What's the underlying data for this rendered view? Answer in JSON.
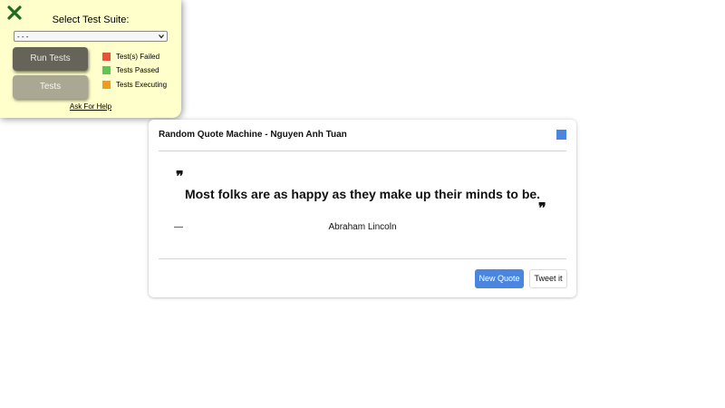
{
  "test_panel": {
    "close_icon": "close-x-icon",
    "title": "Select Test Suite:",
    "select_value": "- - -",
    "run_button": "Run Tests",
    "tests_button": "Tests",
    "legend": [
      {
        "label": "Test(s) Failed",
        "color": "#e8513a"
      },
      {
        "label": "Tests Passed",
        "color": "#5cc852"
      },
      {
        "label": "Tests Executing",
        "color": "#f19a1e"
      }
    ],
    "help_link": "Ask For Help",
    "colors": {
      "panel_bg": "#ffffcc",
      "close_icon": "#1f6b1f"
    }
  },
  "card": {
    "title": "Random Quote Machine - Nguyen Anh Tuan",
    "theme_color": "#4a86e0",
    "open_quote": "❞",
    "quote": "Most folks are as happy as they make up their minds to be.",
    "close_quote": "❞",
    "dash": "—",
    "author": "Abraham Lincoln",
    "new_quote_button": "New Quote",
    "tweet_button": "Tweet it"
  }
}
